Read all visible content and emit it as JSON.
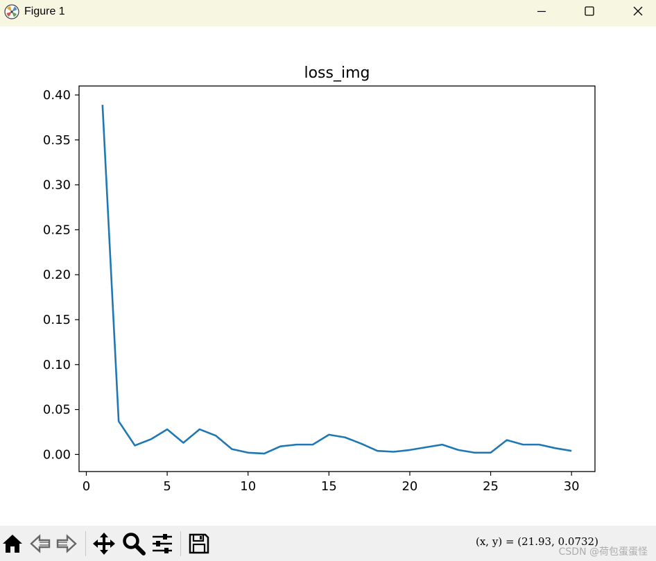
{
  "window": {
    "title": "Figure 1",
    "icon": "matplotlib-logo-icon",
    "controls": [
      "minimize-icon",
      "maximize-icon",
      "close-icon"
    ]
  },
  "toolbar": {
    "buttons": [
      {
        "name": "home",
        "icon": "home-icon"
      },
      {
        "name": "back",
        "icon": "arrow-left-icon"
      },
      {
        "name": "forward",
        "icon": "arrow-right-icon"
      },
      {
        "name": "pan",
        "icon": "move-icon"
      },
      {
        "name": "zoom",
        "icon": "magnifier-icon"
      },
      {
        "name": "configure-subplots",
        "icon": "sliders-icon"
      },
      {
        "name": "save",
        "icon": "floppy-disk-icon"
      }
    ],
    "coords_text": "(x, y) = (21.93, 0.0732)"
  },
  "watermark": "CSDN @荷包蛋蛋怪",
  "chart_data": {
    "type": "line",
    "title": "loss_img",
    "xlabel": "",
    "ylabel": "",
    "xlim": [
      -0.45,
      31.45
    ],
    "ylim": [
      -0.019,
      0.41
    ],
    "xticks": [
      0,
      5,
      10,
      15,
      20,
      25,
      30
    ],
    "yticks": [
      0.0,
      0.05,
      0.1,
      0.15,
      0.2,
      0.25,
      0.3,
      0.35,
      0.4
    ],
    "ytick_labels": [
      "0.00",
      "0.05",
      "0.10",
      "0.15",
      "0.20",
      "0.25",
      "0.30",
      "0.35",
      "0.40"
    ],
    "grid": false,
    "line_color": "#1f77b4",
    "series": [
      {
        "x": [
          1,
          2,
          3,
          4,
          5,
          6,
          7,
          8,
          9,
          10,
          11,
          12,
          13,
          14,
          15,
          16,
          17,
          18,
          19,
          20,
          21,
          22,
          23,
          24,
          25,
          26,
          27,
          28,
          29,
          30
        ],
        "values": [
          0.389,
          0.037,
          0.01,
          0.017,
          0.028,
          0.013,
          0.028,
          0.021,
          0.006,
          0.002,
          0.001,
          0.009,
          0.011,
          0.011,
          0.022,
          0.019,
          0.012,
          0.004,
          0.003,
          0.005,
          0.008,
          0.011,
          0.005,
          0.002,
          0.002,
          0.016,
          0.011,
          0.011,
          0.007,
          0.004
        ]
      }
    ]
  }
}
